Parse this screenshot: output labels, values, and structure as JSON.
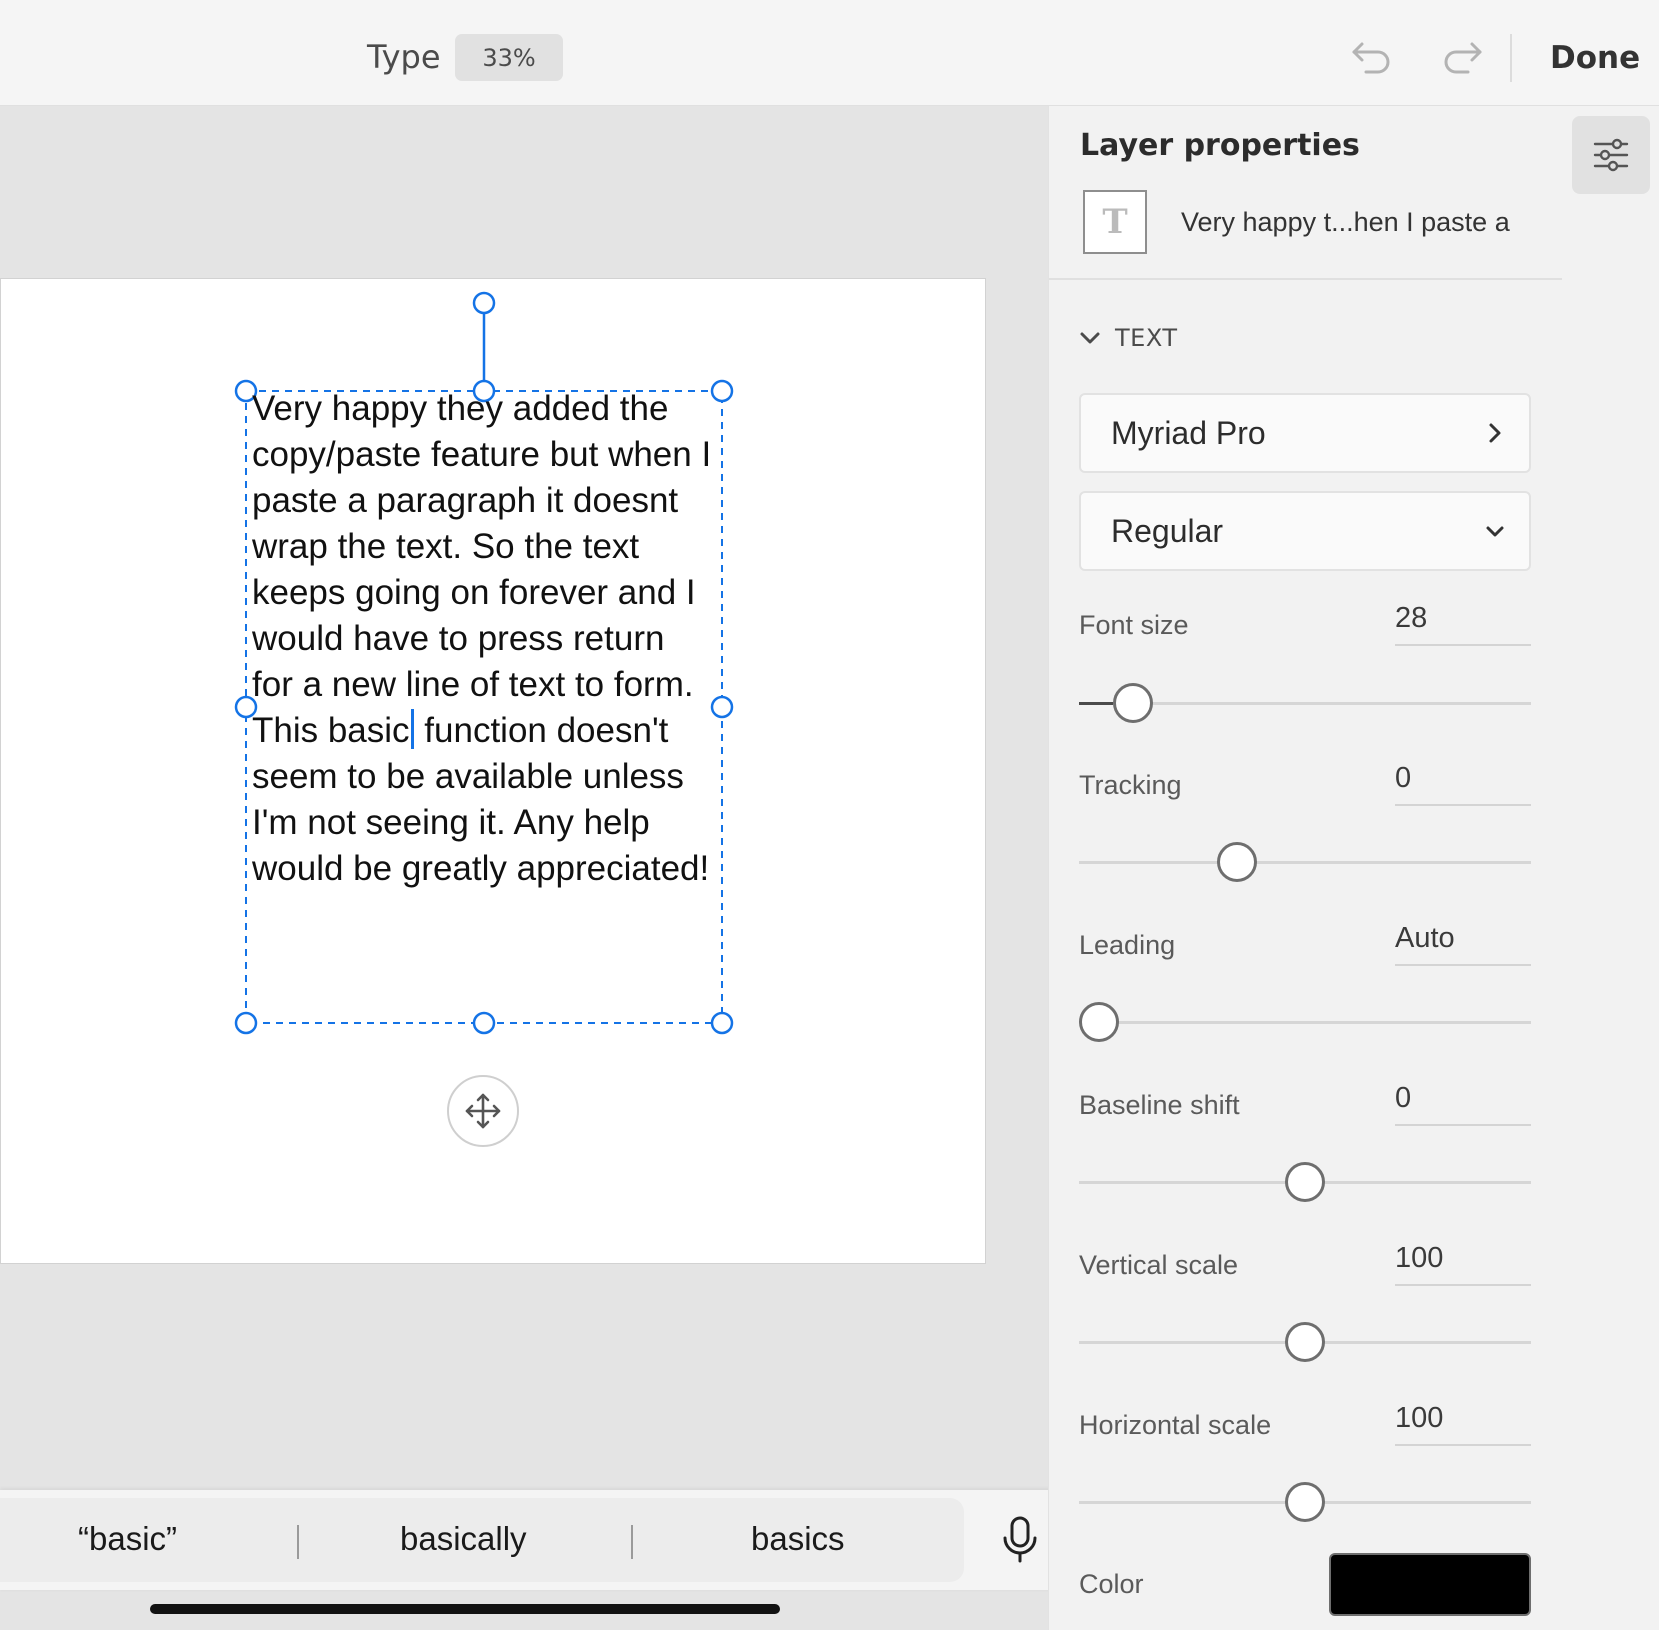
{
  "topbar": {
    "mode_label": "Type",
    "zoom": "33%",
    "done_label": "Done"
  },
  "canvas": {
    "text_before_caret": "Very happy they added the copy/paste feature but when I paste a paragraph it doesnt wrap the text. So the text keeps going on forever and I would have to press return for a new line of text to form. This basic",
    "text_after_caret": " function doesn't seem to be available unless I'm not seeing it. Any help would be greatly appreciated!"
  },
  "quicktype": {
    "suggestions": [
      "“basic”",
      "basically",
      "basics"
    ]
  },
  "panel": {
    "title": "Layer properties",
    "layer_name": "Very happy t...hen I paste a",
    "layer_icon_glyph": "T",
    "section": "TEXT",
    "font_family": "Myriad Pro",
    "font_style": "Regular",
    "props": {
      "font_size": {
        "label": "Font size",
        "value": "28",
        "level": 0.12
      },
      "tracking": {
        "label": "Tracking",
        "value": "0",
        "level": 0.35
      },
      "leading": {
        "label": "Leading",
        "value": "Auto",
        "level": 0.0
      },
      "baseline_shift": {
        "label": "Baseline shift",
        "value": "0",
        "level": 0.5
      },
      "vertical_scale": {
        "label": "Vertical scale",
        "value": "100",
        "level": 0.5
      },
      "horizontal_scale": {
        "label": "Horizontal scale",
        "value": "100",
        "level": 0.5
      }
    },
    "color_label": "Color",
    "color_value": "#000000"
  },
  "colors": {
    "accent": "#1473e6",
    "panel_bg": "#f2f2f2"
  }
}
